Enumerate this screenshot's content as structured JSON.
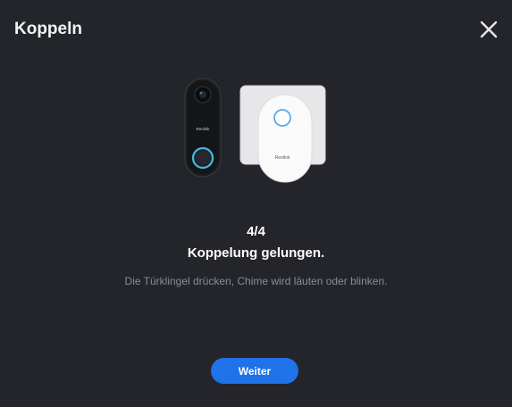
{
  "dialog": {
    "title": "Koppeln",
    "close_icon": "close-icon"
  },
  "illustration": {
    "doorbell_brand": "Reolink",
    "chime_brand": "Reolink"
  },
  "content": {
    "step": "4/4",
    "heading": "Koppelung gelungen.",
    "description": "Die Türklingel drücken, Chime wird läuten oder blinken."
  },
  "actions": {
    "next_label": "Weiter"
  },
  "colors": {
    "background": "#24252b",
    "accent": "#1f72e8",
    "text_primary": "#ffffff",
    "text_secondary": "#8a8d95"
  }
}
